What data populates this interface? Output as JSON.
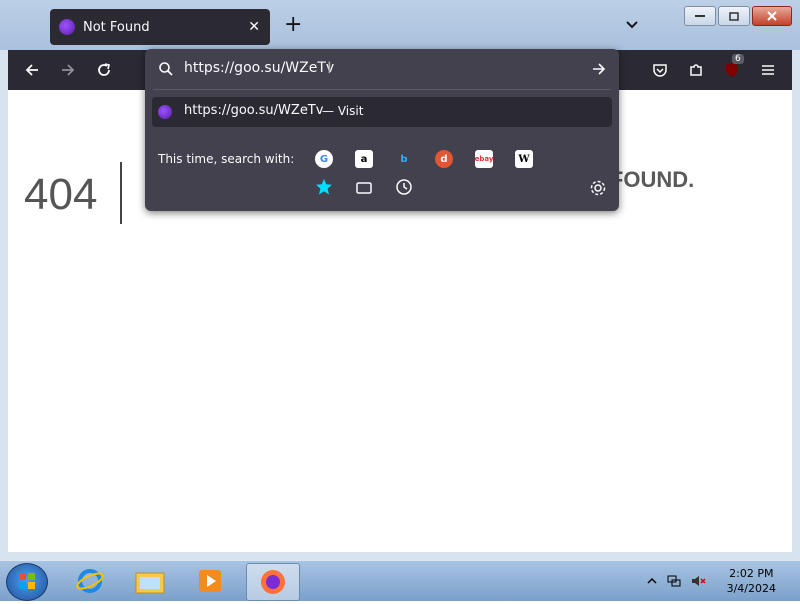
{
  "browser": {
    "tab": {
      "title": "Not Found",
      "close_label": "✕",
      "new_tab_label": "+"
    },
    "extensions_badge": "6"
  },
  "page": {
    "code": "404",
    "message": "...R COULD NOT BE FOUND."
  },
  "urlbar": {
    "value": "https://goo.su/WZeTv",
    "result": {
      "url": "https://goo.su/WZeTv",
      "separator": "—",
      "action": "Visit"
    },
    "search_with_label": "This time, search with:",
    "engines": [
      "google-icon",
      "amazon-icon",
      "bing-icon",
      "duckduckgo-icon",
      "ebay-icon",
      "wikipedia-icon"
    ],
    "modes": [
      "bookmarks-icon",
      "tabs-icon",
      "history-icon"
    ]
  },
  "taskbar": {
    "time": "2:02 PM",
    "date": "3/4/2024",
    "items": [
      "ie-icon",
      "explorer-icon",
      "media-player-icon",
      "firefox-icon"
    ]
  },
  "colors": {
    "toolbar": "#2b2a33",
    "popup": "#42414d",
    "text_light": "#fbfbfe"
  }
}
